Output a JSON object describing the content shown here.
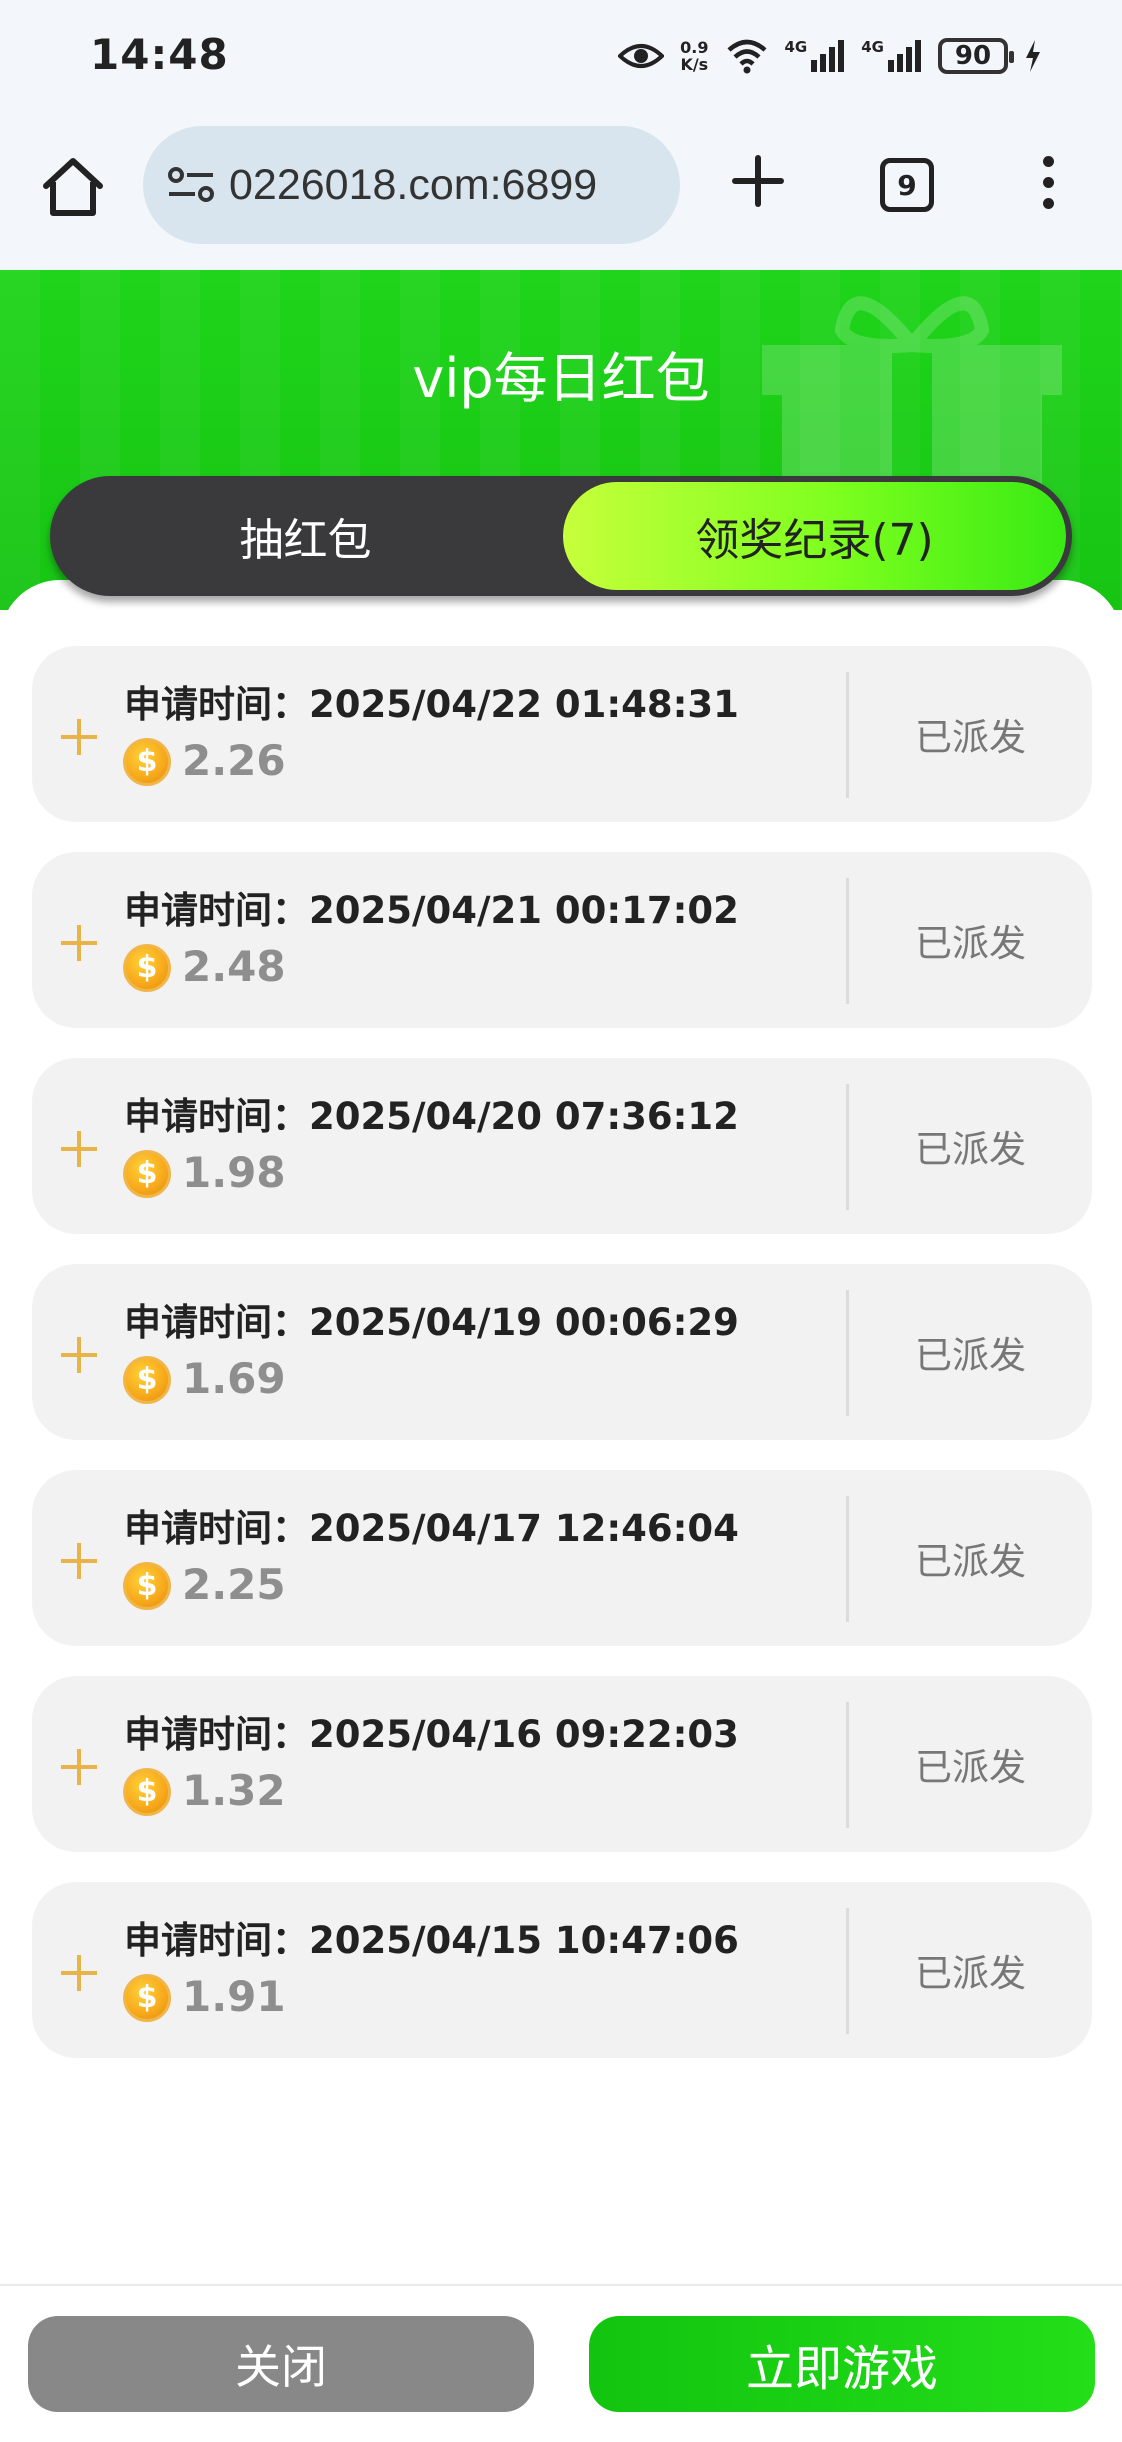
{
  "status_bar": {
    "time": "14:48",
    "speed_value": "0.9",
    "speed_unit": "K/s",
    "net1": "4G",
    "net2": "4G",
    "battery": "90"
  },
  "browser": {
    "url": "0226018.com:6899",
    "tab_count": "9",
    "icons": [
      "home-icon",
      "tune-icon",
      "plus-icon",
      "menu-icon"
    ]
  },
  "header": {
    "title": "vip每日红包"
  },
  "tabs": {
    "draw_label": "抽红包",
    "records_label": "领奖纪录(7)"
  },
  "records": [
    {
      "time_label": "申请时间：2025/04/22 01:48:31",
      "amount": "2.26",
      "status": "已派发"
    },
    {
      "time_label": "申请时间：2025/04/21 00:17:02",
      "amount": "2.48",
      "status": "已派发"
    },
    {
      "time_label": "申请时间：2025/04/20 07:36:12",
      "amount": "1.98",
      "status": "已派发"
    },
    {
      "time_label": "申请时间：2025/04/19 00:06:29",
      "amount": "1.69",
      "status": "已派发"
    },
    {
      "time_label": "申请时间：2025/04/17 12:46:04",
      "amount": "2.25",
      "status": "已派发"
    },
    {
      "time_label": "申请时间：2025/04/16 09:22:03",
      "amount": "1.32",
      "status": "已派发"
    },
    {
      "time_label": "申请时间：2025/04/15 10:47:06",
      "amount": "1.91",
      "status": "已派发"
    }
  ],
  "coin_symbol": "$",
  "footer": {
    "close_label": "关闭",
    "play_label": "立即游戏"
  },
  "colors": {
    "brand_green": "#1fd41a",
    "tab_dark": "#3a3a3c",
    "plus_gold": "#e8b44a"
  }
}
